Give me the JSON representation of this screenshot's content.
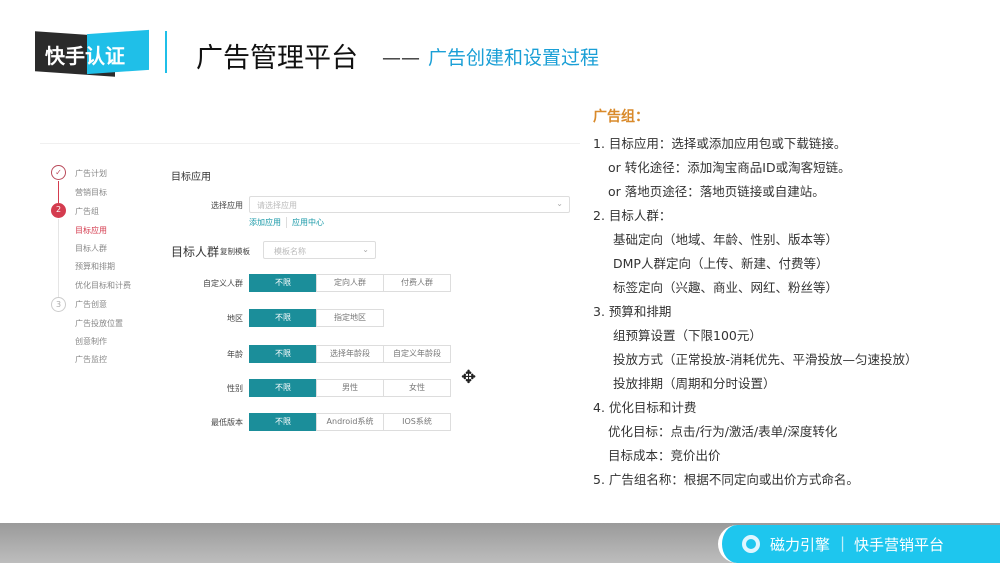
{
  "header": {
    "logo": "快手认证",
    "title": "广告管理平台",
    "dash": "——",
    "subtitle": "广告创建和设置过程"
  },
  "sidebar": {
    "steps": [
      {
        "n": "✓"
      },
      {
        "n": "2"
      },
      {
        "n": "3"
      }
    ],
    "items": [
      "广告计划",
      "营销目标",
      "广告组",
      "目标应用",
      "目标人群",
      "预算和排期",
      "优化目标和计费",
      "广告创意",
      "广告投放位置",
      "创意制作",
      "广告监控"
    ],
    "active": "目标应用"
  },
  "form": {
    "section1": "目标应用",
    "select_app_label": "选择应用",
    "select_app_placeholder": "请选择应用",
    "add_app": "添加应用",
    "app_center": "应用中心",
    "section2": "目标人群",
    "copy_template": "复制模板",
    "template_placeholder": "模板名称",
    "rows": [
      {
        "label": "自定义人群",
        "options": [
          "不限",
          "定向人群",
          "付费人群"
        ]
      },
      {
        "label": "地区",
        "options": [
          "不限",
          "指定地区"
        ]
      },
      {
        "label": "年龄",
        "options": [
          "不限",
          "选择年龄段",
          "自定义年龄段"
        ]
      },
      {
        "label": "性别",
        "options": [
          "不限",
          "男性",
          "女性"
        ]
      },
      {
        "label": "最低版本",
        "options": [
          "不限",
          "Android系统",
          "IOS系统"
        ]
      }
    ]
  },
  "notes": [
    "广告组：",
    "1. 目标应用：选择或添加应用包或下载链接。",
    "or 转化途径：添加淘宝商品ID或淘客短链。",
    "or 落地页途径：落地页链接或自建站。",
    "2. 目标人群：",
    "基础定向（地域、年龄、性别、版本等）",
    "DMP人群定向（上传、新建、付费等）",
    "标签定向（兴趣、商业、网红、粉丝等）",
    "3. 预算和排期",
    "组预算设置（下限100元）",
    "投放方式（正常投放-消耗优先、平滑投放—匀速投放）",
    "投放排期（周期和分时设置）",
    "4. 优化目标和计费",
    "优化目标：点击/行为/激活/表单/深度转化",
    "目标成本：竞价出价",
    "5. 广告组名称：根据不同定向或出价方式命名。"
  ],
  "footer": {
    "brand": "磁力引擎",
    "sep": "|",
    "platform": "快手营销平台"
  },
  "colors": {
    "accent": "#1b8e9a",
    "brand_blue": "#1ec6ee",
    "step_red": "#d43c4f",
    "heading_orange": "#d98a2b"
  }
}
